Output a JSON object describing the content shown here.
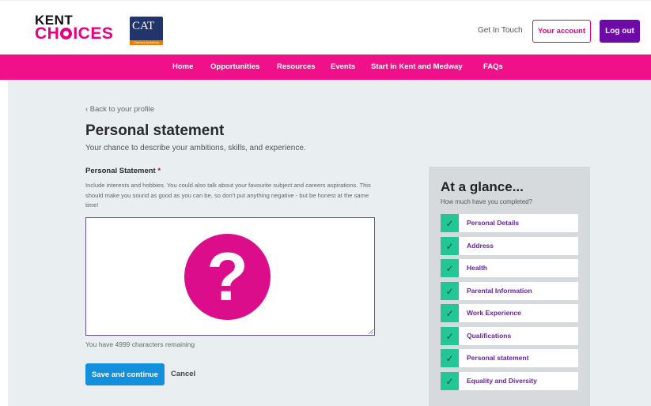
{
  "header": {
    "logo_line1": "KENT",
    "logo_line2_pre": "CH",
    "logo_line2_post": "ICES",
    "partner_logo_text": "CAT",
    "partner_logo_bar": "Careers Academy",
    "get_in_touch": "Get In Touch",
    "your_account": "Your account",
    "log_out": "Log out"
  },
  "nav": {
    "items": [
      "Home",
      "Opportunities",
      "Resources",
      "Events",
      "Start in Kent and Medway",
      "FAQs"
    ]
  },
  "page": {
    "back_link": "‹ Back to your profile",
    "title": "Personal statement",
    "subtitle": "Your chance to describe your ambitions, skills, and experience.",
    "field_label": "Personal Statement",
    "required_mark": "*",
    "hint": "Include interests and hobbies. You could also talk about your favourite subject and careers aspirations. This should make you sound as good as you can be, so don't put anything negative - but be honest at the same time!",
    "placeholder_icon": "question-mark-icon",
    "placeholder_glyph": "?",
    "remaining": "You have 4999 characters remaining",
    "save_button": "Save and continue",
    "cancel": "Cancel"
  },
  "glance": {
    "title": "At a glance...",
    "subtitle": "How much have you completed?",
    "check_glyph": "✓",
    "items": [
      {
        "label": "Personal Details",
        "complete": true
      },
      {
        "label": "Address",
        "complete": true
      },
      {
        "label": "Health",
        "complete": true
      },
      {
        "label": "Parental Information",
        "complete": true
      },
      {
        "label": "Work Experience",
        "complete": true
      },
      {
        "label": "Qualifications",
        "complete": true
      },
      {
        "label": "Personal statement",
        "complete": true
      },
      {
        "label": "Equality and Diversity",
        "complete": true
      }
    ]
  },
  "colors": {
    "brand_pink": "#ef108a",
    "brand_purple": "#6e0aa5",
    "save_blue": "#1390dc",
    "check_green": "#23c795"
  }
}
